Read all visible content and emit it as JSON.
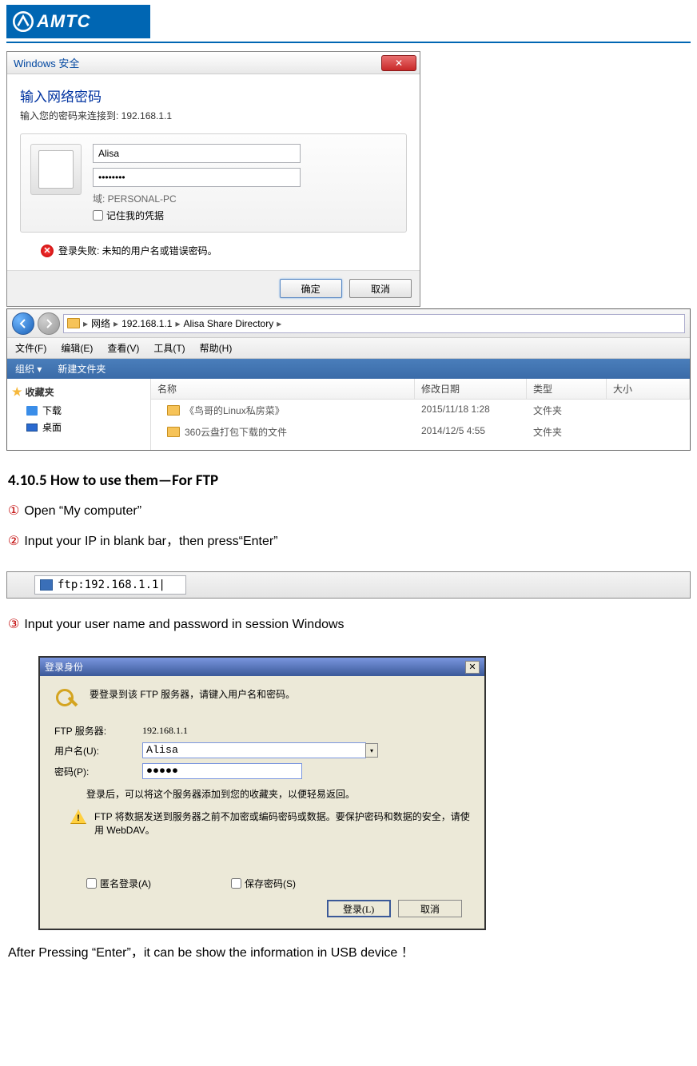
{
  "logo": {
    "text": "AMTC"
  },
  "winsec": {
    "title": "Windows 安全",
    "heading": "输入网络密码",
    "sub": "输入您的密码来连接到: 192.168.1.1",
    "user": "Alisa",
    "pass": "••••••••",
    "domain": "域: PERSONAL-PC",
    "remember": "记住我的凭据",
    "error": "登录失败: 未知的用户名或错误密码。",
    "ok": "确定",
    "cancel": "取消"
  },
  "explorer": {
    "crumbs": [
      "网络",
      "192.168.1.1",
      "Alisa Share Directory"
    ],
    "menu": [
      "文件(F)",
      "编辑(E)",
      "查看(V)",
      "工具(T)",
      "帮助(H)"
    ],
    "toolbar": [
      "组织 ▾",
      "新建文件夹"
    ],
    "side": {
      "fav": "收藏夹",
      "downloads": "下载",
      "desktop": "桌面"
    },
    "cols": {
      "name": "名称",
      "date": "修改日期",
      "type": "类型",
      "size": "大小"
    },
    "rows": [
      {
        "name": "《鸟哥的Linux私房菜》",
        "date": "2015/11/18 1:28",
        "type": "文件夹"
      },
      {
        "name": "360云盘打包下载的文件",
        "date": "2014/12/5 4:55",
        "type": "文件夹"
      }
    ]
  },
  "doc": {
    "heading": "4.10.5 How to use them—For FTP",
    "step1": "Open “My computer”",
    "step2": "Input your IP in blank bar，then press“Enter”",
    "step3": "Input your user name and password in session Windows",
    "final": "After Pressing “Enter”，it can be show the information in USB device ！",
    "ftp_addr": "ftp:192.168.1.1|"
  },
  "ftp": {
    "title": "登录身份",
    "intro": "要登录到该 FTP 服务器，请键入用户名和密码。",
    "server_l": "FTP 服务器:",
    "server_v": "192.168.1.1",
    "user_l": "用户名(U):",
    "user_v": "Alisa",
    "pass_l": "密码(P):",
    "pass_v": "●●●●●",
    "note": "登录后，可以将这个服务器添加到您的收藏夹，以便轻易返回。",
    "warn": "FTP 将数据发送到服务器之前不加密或编码密码或数据。要保护密码和数据的安全，请使用 WebDAV。",
    "anon": "匿名登录(A)",
    "save": "保存密码(S)",
    "login": "登录(L)",
    "cancel": "取消"
  }
}
